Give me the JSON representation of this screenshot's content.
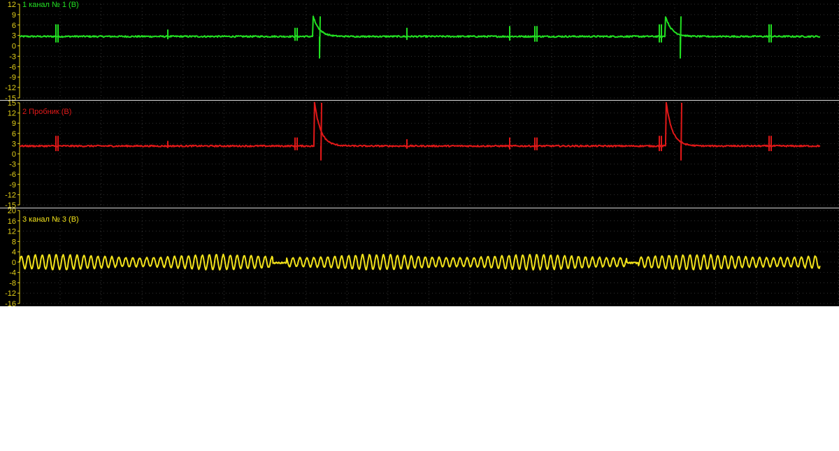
{
  "chart_data": [
    {
      "type": "line",
      "title": "1 канал № 1 (В)",
      "color": "#22e022",
      "ylim": [
        -15,
        12
      ],
      "yticks": [
        12,
        9,
        6,
        3,
        0,
        -3,
        -6,
        -9,
        -12,
        -15
      ],
      "xlim": [
        0,
        1200
      ],
      "baseline": 2.7,
      "grid": true,
      "spikes": [
        {
          "x": 80,
          "kind": "double",
          "amp": 3.5
        },
        {
          "x": 240,
          "kind": "small",
          "amp": 2.0
        },
        {
          "x": 422,
          "kind": "double",
          "amp": 2.5
        },
        {
          "x": 458,
          "kind": "pulse",
          "peak": 8.5,
          "dip": -3.5
        },
        {
          "x": 582,
          "kind": "small",
          "amp": 2.5
        },
        {
          "x": 729,
          "kind": "small",
          "amp": 3.0
        },
        {
          "x": 765,
          "kind": "double",
          "amp": 3.0
        },
        {
          "x": 943,
          "kind": "double",
          "amp": 3.5
        },
        {
          "x": 974,
          "kind": "pulse",
          "peak": 8.5,
          "dip": -3.5
        },
        {
          "x": 1100,
          "kind": "double",
          "amp": 3.5
        }
      ]
    },
    {
      "type": "line",
      "title": "2 Пробник (В)",
      "color": "#e01818",
      "ylim": [
        -15,
        15
      ],
      "yticks": [
        15,
        12,
        9,
        6,
        3,
        0,
        -3,
        -6,
        -9,
        -12,
        -15
      ],
      "xlim": [
        0,
        1200
      ],
      "baseline": 2.3,
      "grid": true,
      "spikes": [
        {
          "x": 80,
          "kind": "double",
          "amp": 3.0
        },
        {
          "x": 240,
          "kind": "small",
          "amp": 1.5
        },
        {
          "x": 422,
          "kind": "double",
          "amp": 2.5
        },
        {
          "x": 460,
          "kind": "pulse",
          "peak": 15,
          "dip": -1.8
        },
        {
          "x": 582,
          "kind": "small",
          "amp": 2.0
        },
        {
          "x": 729,
          "kind": "small",
          "amp": 2.5
        },
        {
          "x": 765,
          "kind": "double",
          "amp": 2.5
        },
        {
          "x": 943,
          "kind": "double",
          "amp": 3.0
        },
        {
          "x": 975,
          "kind": "pulse",
          "peak": 15,
          "dip": -1.8
        },
        {
          "x": 1100,
          "kind": "double",
          "amp": 3.0
        }
      ]
    },
    {
      "type": "line",
      "title": "3  канал № 3 (В)",
      "color": "#f2e21a",
      "ylim": [
        -16,
        20
      ],
      "yticks": [
        20,
        16,
        12,
        8,
        4,
        0,
        -4,
        -8,
        -12,
        -16
      ],
      "xlim": [
        0,
        1200
      ],
      "grid": true,
      "oscillation": {
        "amplitude": 2.3,
        "period": 10.2,
        "gaps": [
          [
            371,
            391
          ],
          [
            889,
            906
          ]
        ],
        "gap_level": -0.3
      }
    }
  ]
}
